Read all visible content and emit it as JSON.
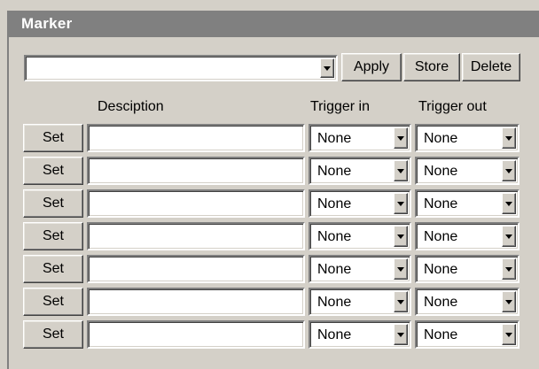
{
  "panel": {
    "title": "Marker"
  },
  "toolbar": {
    "preset_value": "",
    "apply_label": "Apply",
    "store_label": "Store",
    "delete_label": "Delete"
  },
  "columns": {
    "description": "Desciption",
    "trigger_in": "Trigger in",
    "trigger_out": "Trigger out"
  },
  "rows": [
    {
      "set_label": "Set",
      "description": "",
      "trigger_in": "None",
      "trigger_out": "None"
    },
    {
      "set_label": "Set",
      "description": "",
      "trigger_in": "None",
      "trigger_out": "None"
    },
    {
      "set_label": "Set",
      "description": "",
      "trigger_in": "None",
      "trigger_out": "None"
    },
    {
      "set_label": "Set",
      "description": "",
      "trigger_in": "None",
      "trigger_out": "None"
    },
    {
      "set_label": "Set",
      "description": "",
      "trigger_in": "None",
      "trigger_out": "None"
    },
    {
      "set_label": "Set",
      "description": "",
      "trigger_in": "None",
      "trigger_out": "None"
    },
    {
      "set_label": "Set",
      "description": "",
      "trigger_in": "None",
      "trigger_out": "None"
    }
  ]
}
